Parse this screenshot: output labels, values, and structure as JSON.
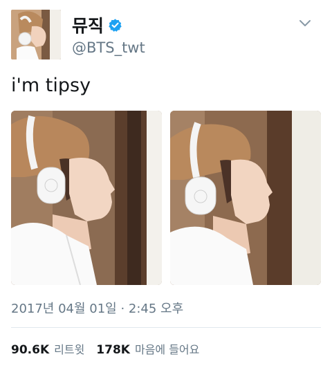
{
  "tweet": {
    "author": {
      "display_name": "뮤직",
      "handle": "@BTS_twt",
      "verified": true,
      "verified_icon": "verified-badge-icon",
      "avatar": "profile-photo"
    },
    "menu_icon": "chevron-down-icon",
    "text": "i'm tipsy",
    "media": [
      {
        "label": "photo-1",
        "description": "person with white headphones, profile view, brown beanie"
      },
      {
        "label": "photo-2",
        "description": "person with white headphones, profile view, brown beanie"
      }
    ],
    "timestamp": "2017년 04월 01일 · 2:45 오후",
    "stats": {
      "retweets_count": "90.6K",
      "retweets_label": "리트윗",
      "likes_count": "178K",
      "likes_label": "마음에 들어요"
    }
  },
  "colors": {
    "text_primary": "#14171a",
    "text_secondary": "#657786",
    "verified": "#1da1f2",
    "divider": "#e1e8ed"
  }
}
